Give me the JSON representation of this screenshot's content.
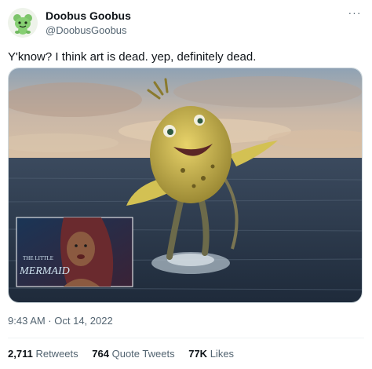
{
  "user": {
    "display_name": "Doobus Goobus",
    "handle": "@DoobusGoobus",
    "avatar_icon": "green-creature-avatar-icon"
  },
  "menu_icon": "more-options-icon",
  "tweet": {
    "text": "Y'know? I think art is dead. yep, definitely dead."
  },
  "media": {
    "description_icon": "fish-creature-image",
    "inset_logo_line1": "THE LITTLE",
    "inset_logo_line2": "MERMAID"
  },
  "timestamp": "9:43 AM · Oct 14, 2022",
  "stats": {
    "retweets_count": "2,711",
    "retweets_label": "Retweets",
    "quotes_count": "764",
    "quotes_label": "Quote Tweets",
    "likes_count": "77K",
    "likes_label": "Likes"
  },
  "colors": {
    "text_primary": "#0f1419",
    "text_secondary": "#536471",
    "border": "#cfd9de"
  }
}
